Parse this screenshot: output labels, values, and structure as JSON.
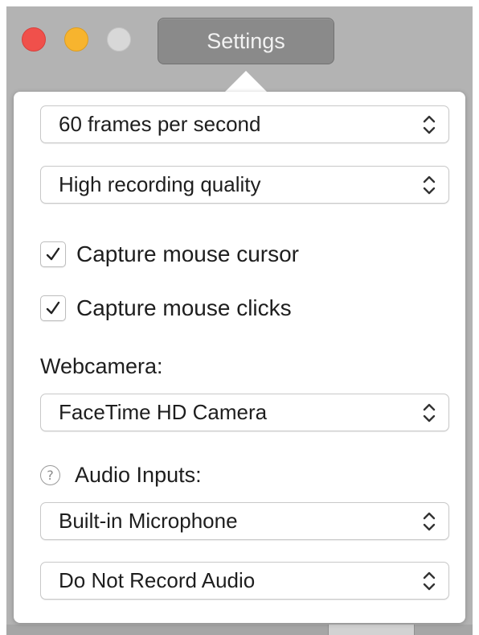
{
  "window": {
    "title_button": "Settings"
  },
  "settings": {
    "frame_rate": {
      "value": "60 frames per second"
    },
    "quality": {
      "value": "High recording quality"
    },
    "capture_cursor": {
      "label": "Capture mouse cursor",
      "checked": true
    },
    "capture_clicks": {
      "label": "Capture mouse clicks",
      "checked": true
    },
    "webcam": {
      "label": "Webcamera:",
      "value": "FaceTime HD Camera"
    },
    "audio": {
      "label": "Audio Inputs:",
      "help_symbol": "?",
      "input_1": "Built-in Microphone",
      "input_2": "Do Not Record Audio"
    }
  },
  "icons": {
    "close": "close-traffic-light-icon",
    "minimize": "minimize-traffic-light-icon",
    "zoom": "zoom-traffic-light-icon",
    "checkmark": "checkmark-icon",
    "select_chevrons": "up-down-chevron-icon",
    "help": "question-mark-icon"
  },
  "colors": {
    "close": "#f0504b",
    "minimize": "#f7b42e",
    "zoom": "#d8d8d8",
    "title_button_bg": "#8a8a8a",
    "window_bg": "#b3b3b3"
  }
}
